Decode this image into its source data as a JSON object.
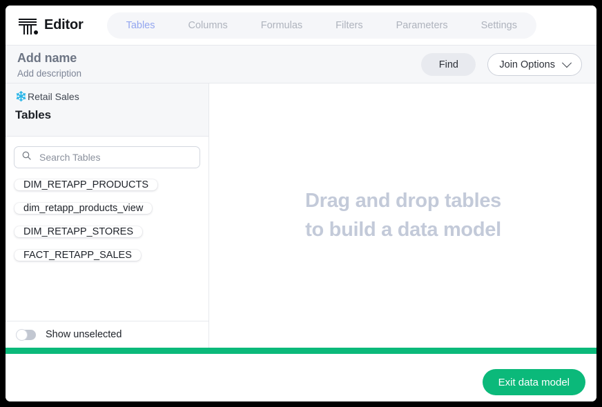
{
  "app": {
    "brand_title": "Editor",
    "logo_icon": "editor-column-logo"
  },
  "tabs": [
    {
      "label": "Tables",
      "active": true
    },
    {
      "label": "Columns",
      "active": false
    },
    {
      "label": "Formulas",
      "active": false
    },
    {
      "label": "Filters",
      "active": false
    },
    {
      "label": "Parameters",
      "active": false
    },
    {
      "label": "Settings",
      "active": false
    }
  ],
  "toolbar": {
    "name_placeholder": "Add name",
    "description_placeholder": "Add description",
    "find_label": "Find",
    "join_options_label": "Join Options",
    "join_options_icon": "chevron-down-icon"
  },
  "sidebar": {
    "source_icon": "snowflake-icon",
    "source_name": "Retail Sales",
    "heading": "Tables",
    "search": {
      "icon": "search-icon",
      "placeholder": "Search Tables",
      "value": ""
    },
    "tables": [
      {
        "name": "DIM_RETAPP_PRODUCTS"
      },
      {
        "name": "dim_retapp_products_view"
      },
      {
        "name": "DIM_RETAPP_STORES"
      },
      {
        "name": "FACT_RETAPP_SALES"
      }
    ],
    "show_unselected_label": "Show unselected",
    "show_unselected_on": false
  },
  "canvas": {
    "hint_line1": "Drag and drop tables",
    "hint_line2": "to build a data model"
  },
  "bottom": {
    "exit_label": "Exit data model"
  },
  "colors": {
    "accent_green": "#0bb97a",
    "tab_active": "#93a6ef",
    "snowflake_blue": "#29b5e8",
    "canvas_hint": "#c3cad9"
  }
}
